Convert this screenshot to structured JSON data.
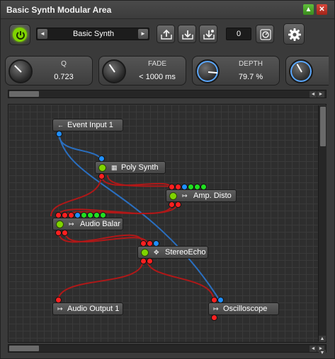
{
  "window": {
    "title": "Basic Synth Modular Area",
    "up_glyph": "▲",
    "close_glyph": "✕"
  },
  "toolbar": {
    "preset_name": "Basic Synth",
    "prev_glyph": "◄",
    "next_glyph": "►",
    "counter": "0"
  },
  "params": [
    {
      "label": "Q",
      "value": "0.723"
    },
    {
      "label": "FADE",
      "value": "< 1000 ms"
    },
    {
      "label": "DEPTH",
      "value": "79.7 %"
    },
    {
      "label": "",
      "value": ""
    }
  ],
  "nodes": {
    "event_input": {
      "label": "Event Input 1",
      "icon": "←"
    },
    "poly_synth": {
      "label": "Poly Synth",
      "icon": "▦"
    },
    "amp_disto": {
      "label": "Amp. Disto",
      "icon": "↦"
    },
    "audio_balance": {
      "label": "Audio Balar",
      "icon": "↦"
    },
    "stereo_echo": {
      "label": "StereoEcho",
      "icon": "✥"
    },
    "audio_output": {
      "label": "Audio Output 1",
      "icon": "↦"
    },
    "oscilloscope": {
      "label": "Oscilloscope",
      "icon": "↦"
    }
  },
  "scroll": {
    "left": "◄",
    "right": "►",
    "up": "▲",
    "down": "▼"
  },
  "colors": {
    "accent": "#7fd400",
    "wire_red": "#b01818",
    "wire_blue": "#2a6fc0"
  }
}
